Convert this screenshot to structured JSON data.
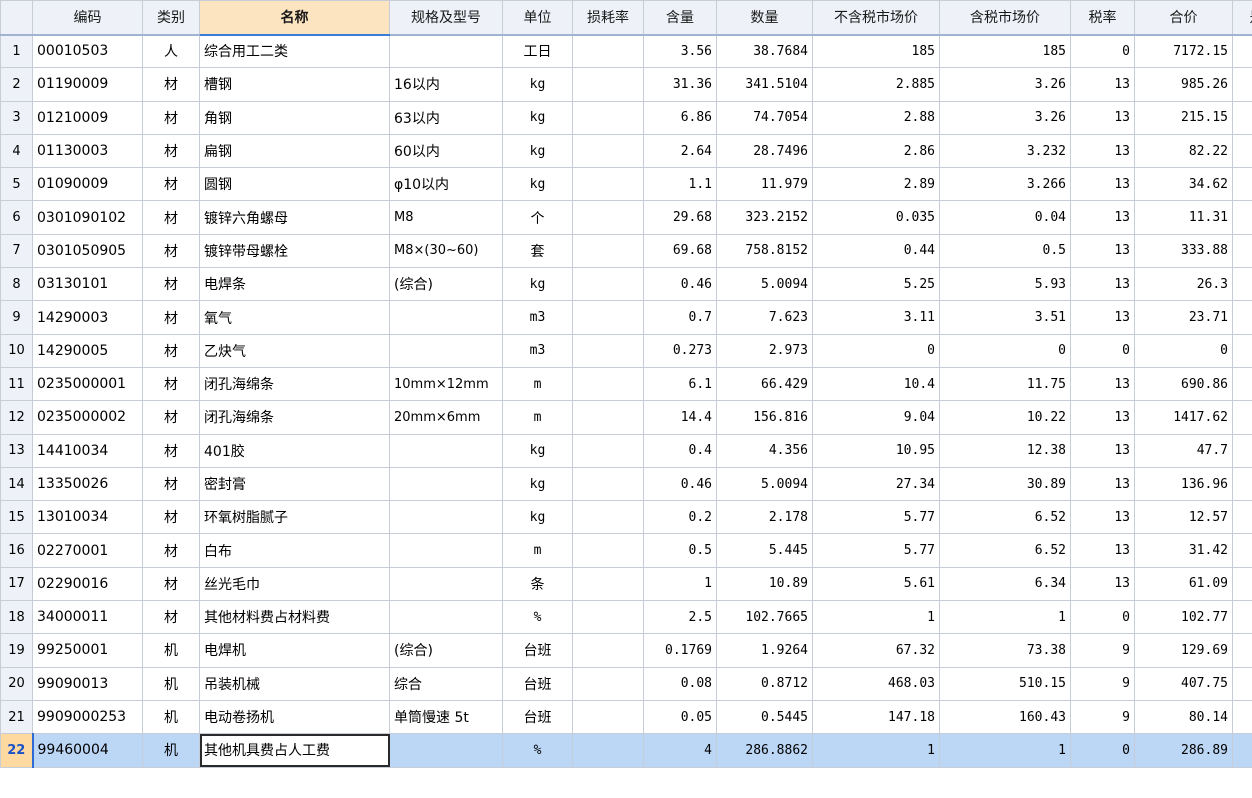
{
  "table": {
    "headers": {
      "rownum": "",
      "code": "编码",
      "category": "类别",
      "name": "名称",
      "spec": "规格及型号",
      "unit": "单位",
      "loss_rate": "损耗率",
      "content": "含量",
      "quantity": "数量",
      "price_ex_tax": "不含税市场价",
      "price_in_tax": "含税市场价",
      "tax_rate": "税率",
      "total": "合价",
      "extra": "是"
    },
    "rows": [
      {
        "no": "1",
        "code": "00010503",
        "category": "人",
        "name": "综合用工二类",
        "spec": "",
        "unit": "工日",
        "loss_rate": "",
        "content": "3.56",
        "quantity": "38.7684",
        "price_ex_tax": "185",
        "price_in_tax": "185",
        "tax_rate": "0",
        "total": "7172.15"
      },
      {
        "no": "2",
        "code": "01190009",
        "category": "材",
        "name": "槽钢",
        "spec": "16以内",
        "unit": "kg",
        "loss_rate": "",
        "content": "31.36",
        "quantity": "341.5104",
        "price_ex_tax": "2.885",
        "price_in_tax": "3.26",
        "tax_rate": "13",
        "total": "985.26"
      },
      {
        "no": "3",
        "code": "01210009",
        "category": "材",
        "name": "角钢",
        "spec": "63以内",
        "unit": "kg",
        "loss_rate": "",
        "content": "6.86",
        "quantity": "74.7054",
        "price_ex_tax": "2.88",
        "price_in_tax": "3.26",
        "tax_rate": "13",
        "total": "215.15"
      },
      {
        "no": "4",
        "code": "01130003",
        "category": "材",
        "name": "扁钢",
        "spec": "60以内",
        "unit": "kg",
        "loss_rate": "",
        "content": "2.64",
        "quantity": "28.7496",
        "price_ex_tax": "2.86",
        "price_in_tax": "3.232",
        "tax_rate": "13",
        "total": "82.22"
      },
      {
        "no": "5",
        "code": "01090009",
        "category": "材",
        "name": "圆钢",
        "spec": "φ10以内",
        "unit": "kg",
        "loss_rate": "",
        "content": "1.1",
        "quantity": "11.979",
        "price_ex_tax": "2.89",
        "price_in_tax": "3.266",
        "tax_rate": "13",
        "total": "34.62"
      },
      {
        "no": "6",
        "code": "0301090102",
        "category": "材",
        "name": "镀锌六角螺母",
        "spec": "M8",
        "unit": "个",
        "loss_rate": "",
        "content": "29.68",
        "quantity": "323.2152",
        "price_ex_tax": "0.035",
        "price_in_tax": "0.04",
        "tax_rate": "13",
        "total": "11.31"
      },
      {
        "no": "7",
        "code": "0301050905",
        "category": "材",
        "name": "镀锌带母螺栓",
        "spec": "M8×(30~60)",
        "unit": "套",
        "loss_rate": "",
        "content": "69.68",
        "quantity": "758.8152",
        "price_ex_tax": "0.44",
        "price_in_tax": "0.5",
        "tax_rate": "13",
        "total": "333.88"
      },
      {
        "no": "8",
        "code": "03130101",
        "category": "材",
        "name": "电焊条",
        "spec": "(综合)",
        "unit": "kg",
        "loss_rate": "",
        "content": "0.46",
        "quantity": "5.0094",
        "price_ex_tax": "5.25",
        "price_in_tax": "5.93",
        "tax_rate": "13",
        "total": "26.3"
      },
      {
        "no": "9",
        "code": "14290003",
        "category": "材",
        "name": "氧气",
        "spec": "",
        "unit": "m3",
        "loss_rate": "",
        "content": "0.7",
        "quantity": "7.623",
        "price_ex_tax": "3.11",
        "price_in_tax": "3.51",
        "tax_rate": "13",
        "total": "23.71"
      },
      {
        "no": "10",
        "code": "14290005",
        "category": "材",
        "name": "乙炔气",
        "spec": "",
        "unit": "m3",
        "loss_rate": "",
        "content": "0.273",
        "quantity": "2.973",
        "price_ex_tax": "0",
        "price_in_tax": "0",
        "tax_rate": "0",
        "total": "0"
      },
      {
        "no": "11",
        "code": "0235000001",
        "category": "材",
        "name": "闭孔海绵条",
        "spec": "10mm×12mm",
        "unit": "m",
        "loss_rate": "",
        "content": "6.1",
        "quantity": "66.429",
        "price_ex_tax": "10.4",
        "price_in_tax": "11.75",
        "tax_rate": "13",
        "total": "690.86"
      },
      {
        "no": "12",
        "code": "0235000002",
        "category": "材",
        "name": "闭孔海绵条",
        "spec": "20mm×6mm",
        "unit": "m",
        "loss_rate": "",
        "content": "14.4",
        "quantity": "156.816",
        "price_ex_tax": "9.04",
        "price_in_tax": "10.22",
        "tax_rate": "13",
        "total": "1417.62"
      },
      {
        "no": "13",
        "code": "14410034",
        "category": "材",
        "name": "401胶",
        "spec": "",
        "unit": "kg",
        "loss_rate": "",
        "content": "0.4",
        "quantity": "4.356",
        "price_ex_tax": "10.95",
        "price_in_tax": "12.38",
        "tax_rate": "13",
        "total": "47.7"
      },
      {
        "no": "14",
        "code": "13350026",
        "category": "材",
        "name": "密封膏",
        "spec": "",
        "unit": "kg",
        "loss_rate": "",
        "content": "0.46",
        "quantity": "5.0094",
        "price_ex_tax": "27.34",
        "price_in_tax": "30.89",
        "tax_rate": "13",
        "total": "136.96"
      },
      {
        "no": "15",
        "code": "13010034",
        "category": "材",
        "name": "环氧树脂腻子",
        "spec": "",
        "unit": "kg",
        "loss_rate": "",
        "content": "0.2",
        "quantity": "2.178",
        "price_ex_tax": "5.77",
        "price_in_tax": "6.52",
        "tax_rate": "13",
        "total": "12.57"
      },
      {
        "no": "16",
        "code": "02270001",
        "category": "材",
        "name": "白布",
        "spec": "",
        "unit": "m",
        "loss_rate": "",
        "content": "0.5",
        "quantity": "5.445",
        "price_ex_tax": "5.77",
        "price_in_tax": "6.52",
        "tax_rate": "13",
        "total": "31.42"
      },
      {
        "no": "17",
        "code": "02290016",
        "category": "材",
        "name": "丝光毛巾",
        "spec": "",
        "unit": "条",
        "loss_rate": "",
        "content": "1",
        "quantity": "10.89",
        "price_ex_tax": "5.61",
        "price_in_tax": "6.34",
        "tax_rate": "13",
        "total": "61.09"
      },
      {
        "no": "18",
        "code": "34000011",
        "category": "材",
        "name": "其他材料费占材料费",
        "spec": "",
        "unit": "%",
        "loss_rate": "",
        "content": "2.5",
        "quantity": "102.7665",
        "price_ex_tax": "1",
        "price_in_tax": "1",
        "tax_rate": "0",
        "total": "102.77"
      },
      {
        "no": "19",
        "code": "99250001",
        "category": "机",
        "name": "电焊机",
        "spec": "(综合)",
        "unit": "台班",
        "loss_rate": "",
        "content": "0.1769",
        "quantity": "1.9264",
        "price_ex_tax": "67.32",
        "price_in_tax": "73.38",
        "tax_rate": "9",
        "total": "129.69"
      },
      {
        "no": "20",
        "code": "99090013",
        "category": "机",
        "name": "吊装机械",
        "spec": "综合",
        "unit": "台班",
        "loss_rate": "",
        "content": "0.08",
        "quantity": "0.8712",
        "price_ex_tax": "468.03",
        "price_in_tax": "510.15",
        "tax_rate": "9",
        "total": "407.75"
      },
      {
        "no": "21",
        "code": "9909000253",
        "category": "机",
        "name": "电动卷扬机",
        "spec": "单筒慢速 5t",
        "unit": "台班",
        "loss_rate": "",
        "content": "0.05",
        "quantity": "0.5445",
        "price_ex_tax": "147.18",
        "price_in_tax": "160.43",
        "tax_rate": "9",
        "total": "80.14"
      },
      {
        "no": "22",
        "code": "99460004",
        "category": "机",
        "name": "其他机具费占人工费",
        "spec": "",
        "unit": "%",
        "loss_rate": "",
        "content": "4",
        "quantity": "286.8862",
        "price_ex_tax": "1",
        "price_in_tax": "1",
        "tax_rate": "0",
        "total": "286.89"
      }
    ],
    "selected_row": 22
  },
  "colors": {
    "header_bg": "#eef2f8",
    "sorted_header_bg": "#fde4c0",
    "selected_row_bg": "#bcd7f6",
    "grid_line": "#c6cdd6"
  }
}
